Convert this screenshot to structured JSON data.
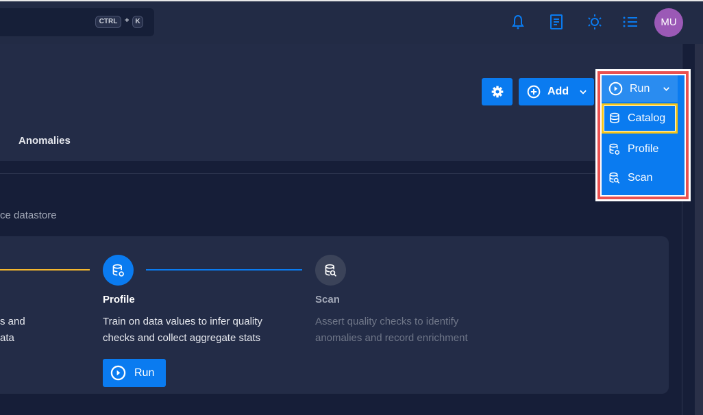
{
  "topbar": {
    "shortcut_ctrl": "CTRL",
    "shortcut_plus": "+",
    "shortcut_k": "K",
    "avatar_initials": "MU",
    "icons": [
      "bell-icon",
      "document-icon",
      "theme-icon",
      "list-icon"
    ],
    "accent": "#0a7bf0"
  },
  "toolbar": {
    "add_label": "Add",
    "run_label": "Run"
  },
  "run_menu": {
    "items": [
      {
        "label": "Catalog",
        "icon": "database-icon",
        "highlighted": true
      },
      {
        "label": "Profile",
        "icon": "database-eye-icon"
      },
      {
        "label": "Scan",
        "icon": "database-search-icon"
      }
    ]
  },
  "tabs": {
    "anomalies": "Anomalies"
  },
  "main": {
    "subtitle_fragment": "ce datastore",
    "steps": [
      {
        "desc_fragment_1": "s and",
        "desc_fragment_2": "ata"
      },
      {
        "title": "Profile",
        "desc": "Train on data values to infer quality checks and collect aggregate stats",
        "run_label": "Run"
      },
      {
        "title": "Scan",
        "desc": "Assert quality checks to identify anomalies and record enrichment"
      }
    ]
  }
}
